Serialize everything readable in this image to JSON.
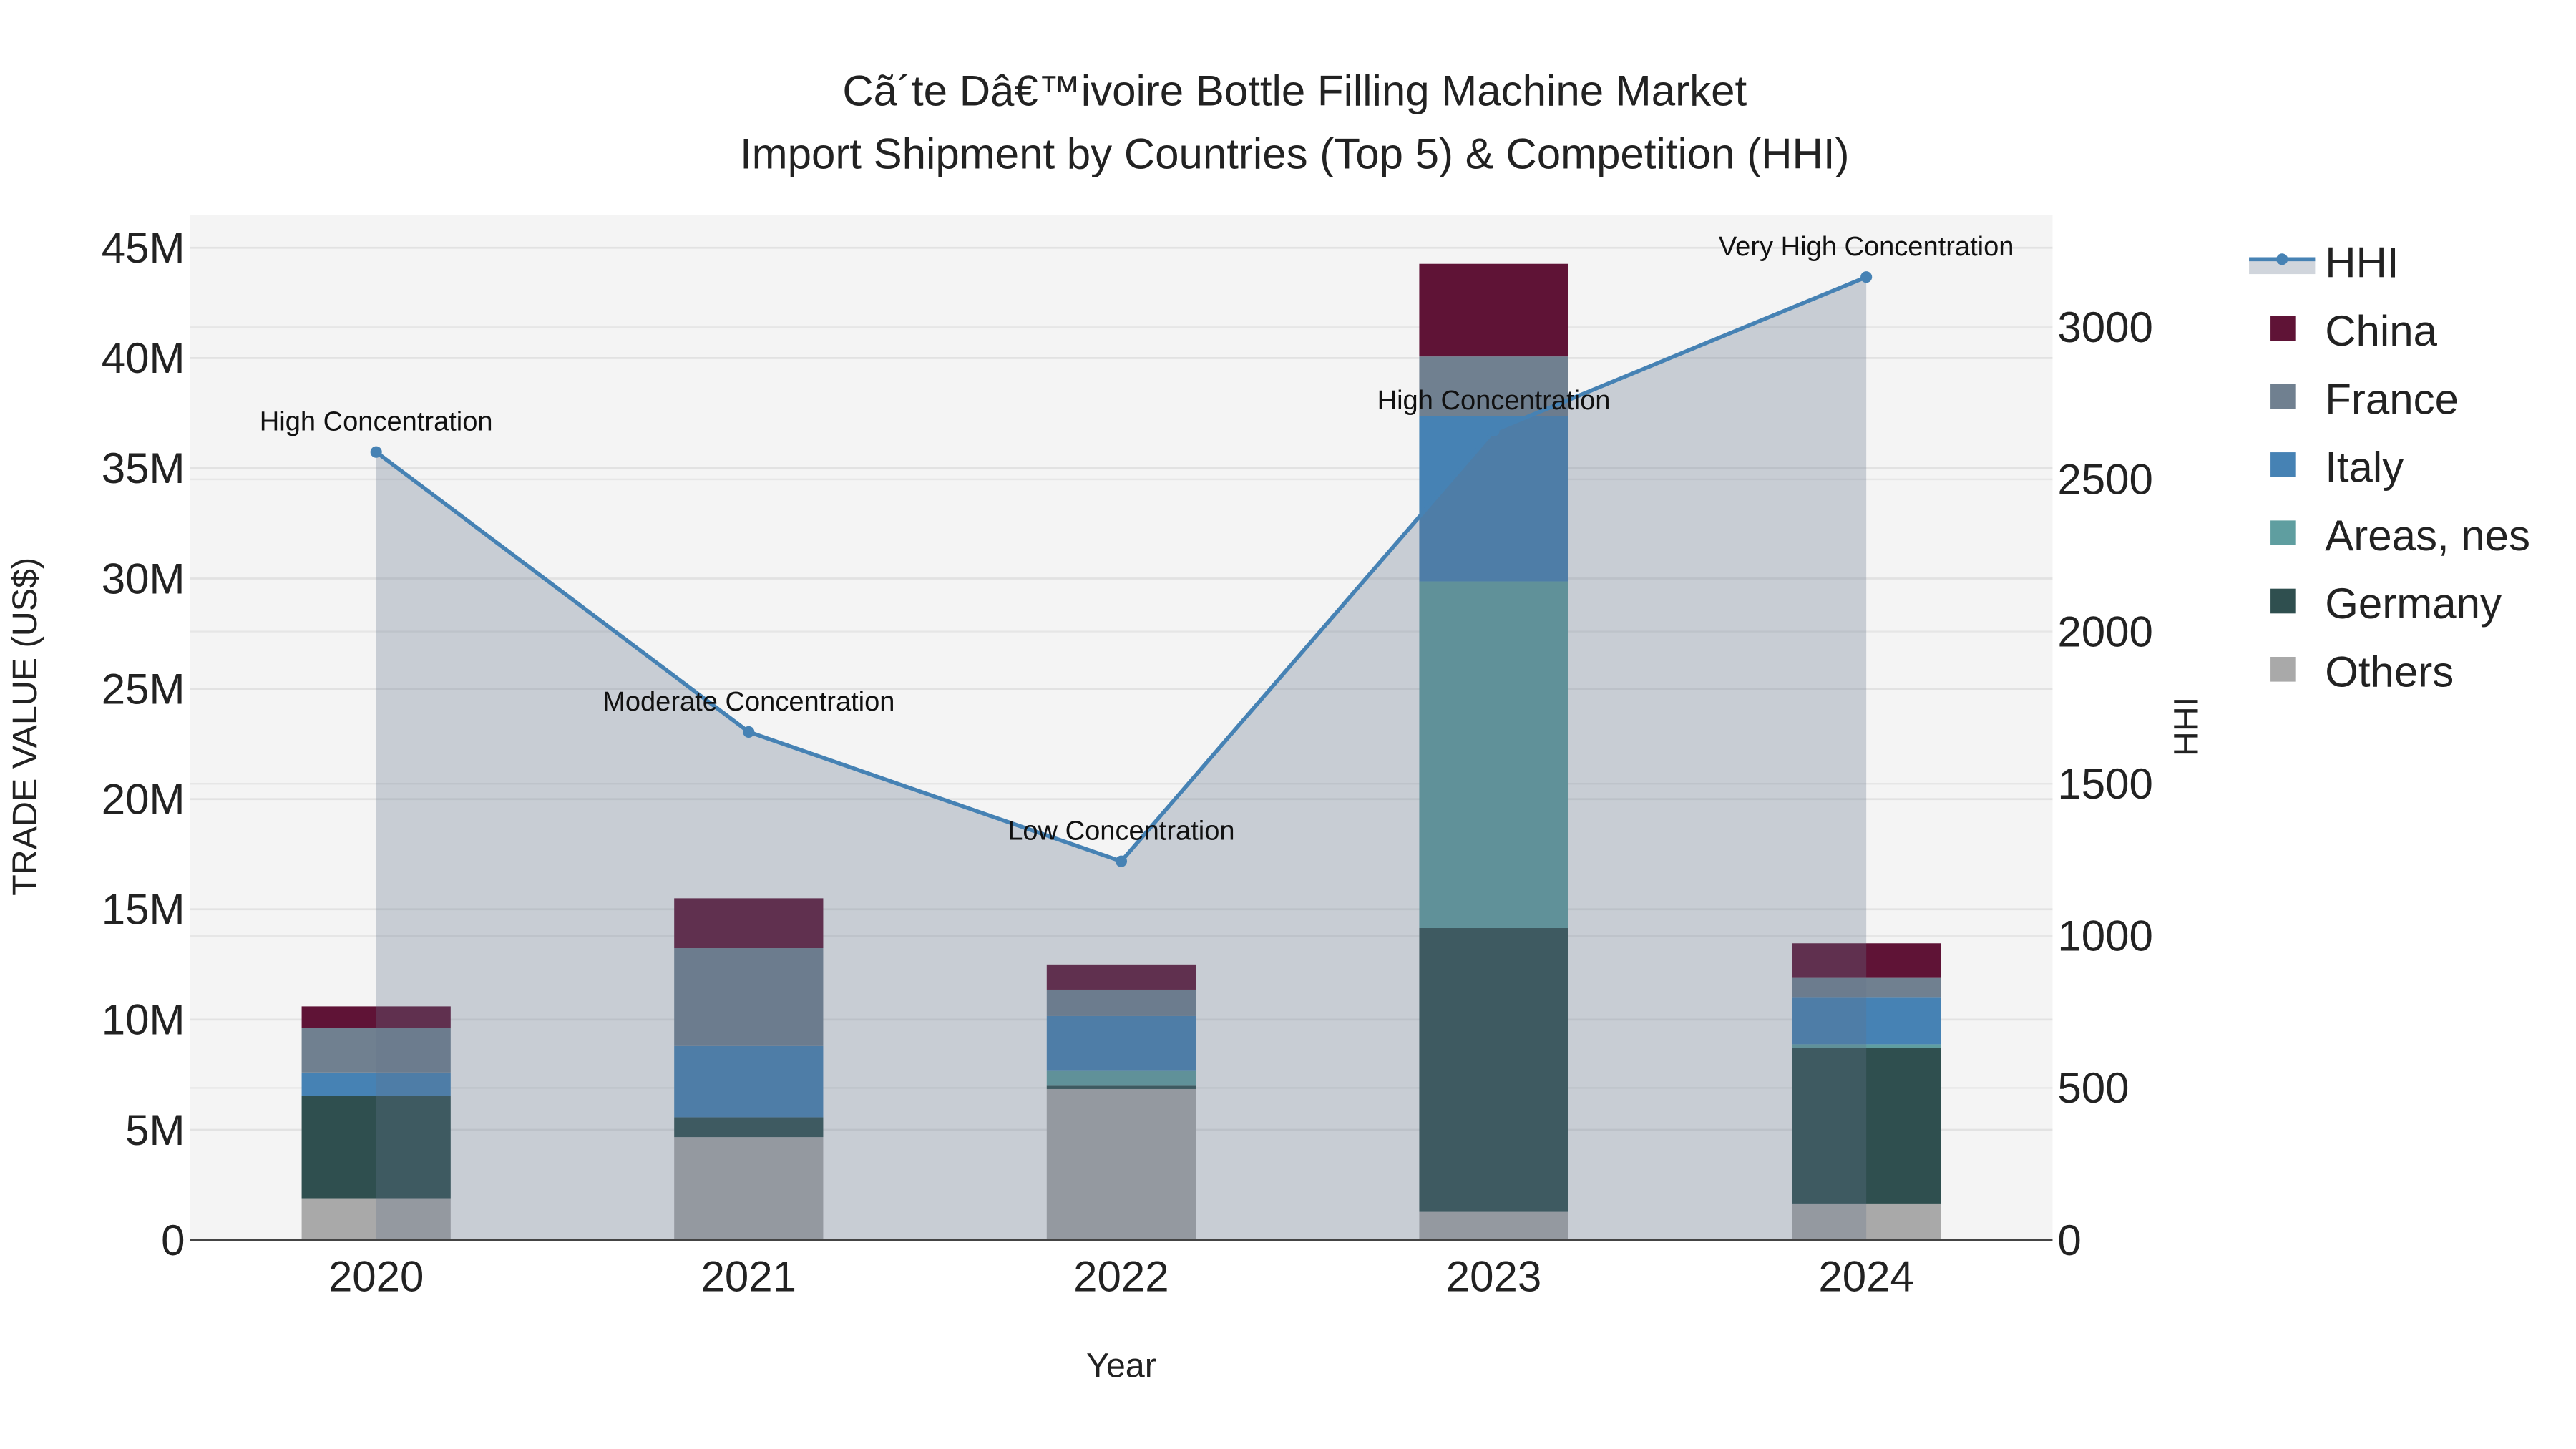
{
  "chart_data": {
    "type": "bar",
    "barmode": "stack",
    "title": "Cã´te Dâ€™ivoire Bottle Filling Machine Market",
    "subtitle": "Import Shipment by Countries (Top 5) & Competition (HHI)",
    "xlabel": "Year",
    "ylabel": "TRADE VALUE (US$)",
    "y2label": "HHI",
    "categories": [
      "2020",
      "2021",
      "2022",
      "2023",
      "2024"
    ],
    "ylim": [
      0,
      46500000
    ],
    "y2lim": [
      0,
      3370
    ],
    "yticks": [
      0,
      5000000,
      10000000,
      15000000,
      20000000,
      25000000,
      30000000,
      35000000,
      40000000,
      45000000
    ],
    "ytick_labels": [
      "0",
      "5M",
      "10M",
      "15M",
      "20M",
      "25M",
      "30M",
      "35M",
      "40M",
      "45M"
    ],
    "y2ticks": [
      0,
      500,
      1000,
      1500,
      2000,
      2500,
      3000
    ],
    "y2tick_labels": [
      "0",
      "500",
      "1000",
      "1500",
      "2000",
      "2500",
      "3000"
    ],
    "grid": true,
    "legend_placement": "right",
    "series": [
      {
        "name": "Others",
        "color": "#a9a9a9",
        "values": [
          1900000,
          4670000,
          6850000,
          1280000,
          1660000
        ]
      },
      {
        "name": "Germany",
        "color": "#2f4f4f",
        "values": [
          4650000,
          900000,
          150000,
          12870000,
          7070000
        ]
      },
      {
        "name": "Areas, nes",
        "color": "#5f9ea0",
        "values": [
          0,
          0,
          670000,
          15720000,
          150000
        ]
      },
      {
        "name": "Italy",
        "color": "#4682b4",
        "values": [
          1050000,
          3230000,
          2490000,
          7500000,
          2110000
        ]
      },
      {
        "name": "France",
        "color": "#708090",
        "values": [
          2030000,
          4440000,
          1200000,
          2700000,
          900000
        ]
      },
      {
        "name": "China",
        "color": "#5f1336",
        "values": [
          970000,
          2260000,
          1140000,
          4200000,
          1570000
        ]
      }
    ],
    "hhi": {
      "name": "HHI",
      "color": "#4682b4",
      "values": [
        2590,
        1670,
        1245,
        2660,
        3165
      ],
      "annotations": [
        "High Concentration",
        "Moderate Concentration",
        "Low Concentration",
        "High Concentration",
        "Very High Concentration"
      ]
    },
    "legend_order": [
      "HHI",
      "China",
      "France",
      "Italy",
      "Areas, nes",
      "Germany",
      "Others"
    ]
  }
}
